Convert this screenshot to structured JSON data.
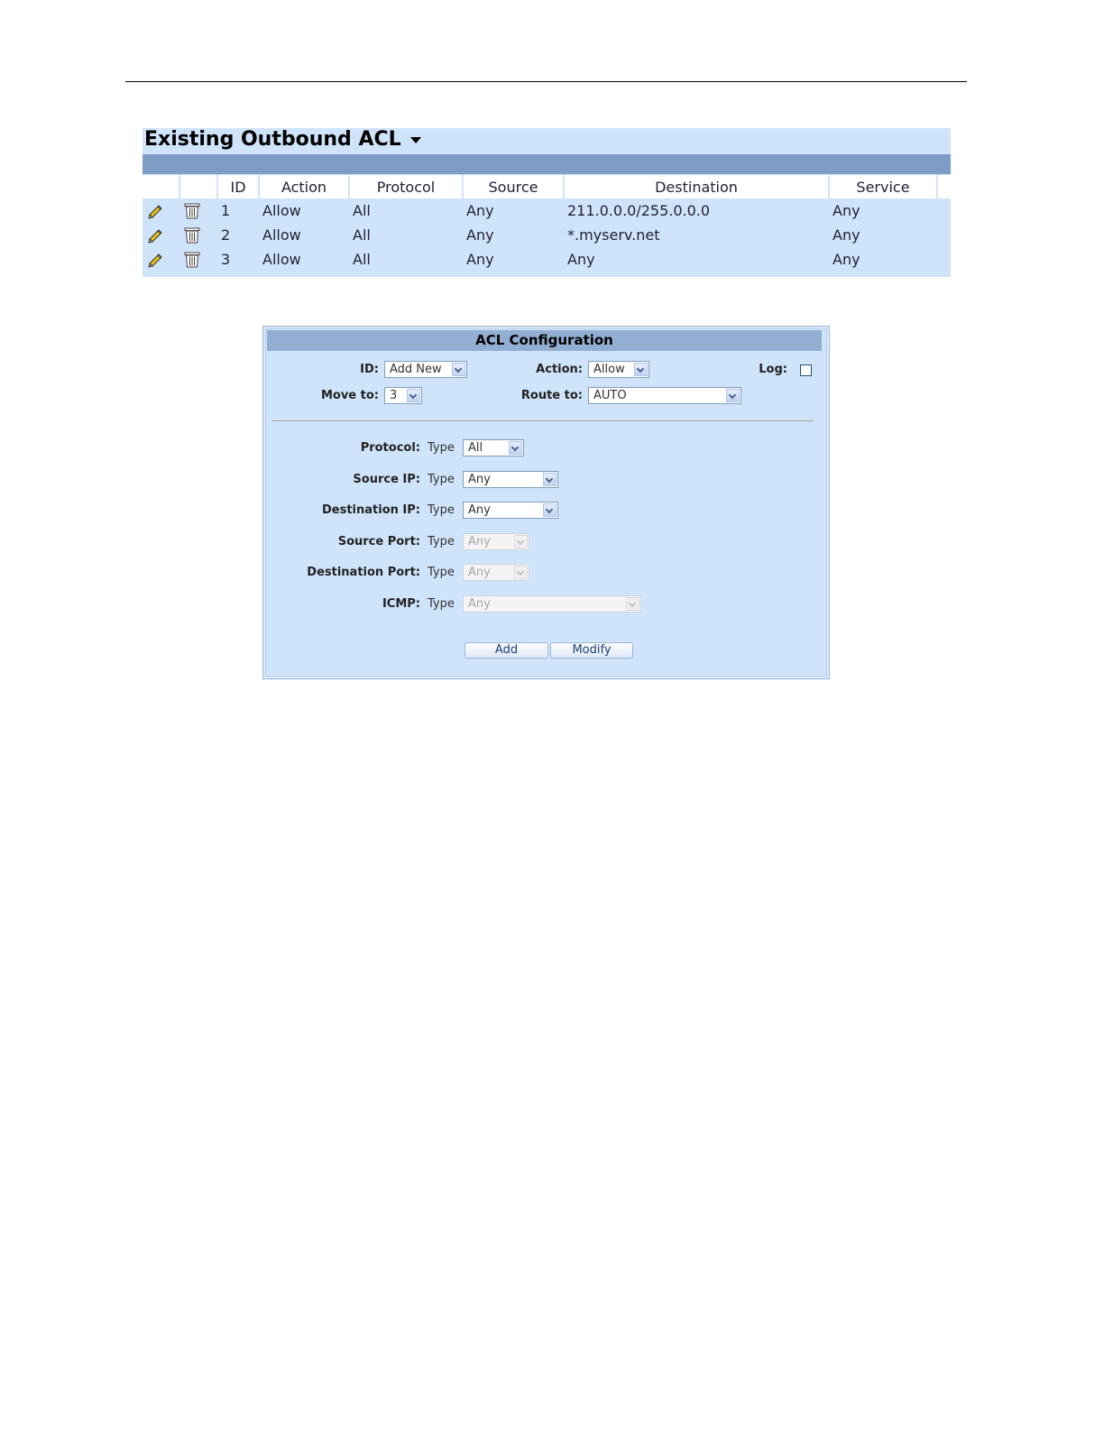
{
  "outbound_acl": {
    "title": "Existing Outbound ACL",
    "columns": [
      "",
      "",
      "ID",
      "Action",
      "Protocol",
      "Source",
      "Destination",
      "Service"
    ],
    "rows": [
      {
        "id": "1",
        "action": "Allow",
        "protocol": "All",
        "source": "Any",
        "destination": "211.0.0.0/255.0.0.0",
        "service": "Any"
      },
      {
        "id": "2",
        "action": "Allow",
        "protocol": "All",
        "source": "Any",
        "destination": "*.myserv.net",
        "service": "Any"
      },
      {
        "id": "3",
        "action": "Allow",
        "protocol": "All",
        "source": "Any",
        "destination": "Any",
        "service": "Any"
      }
    ],
    "row_icons": [
      "pencil-icon",
      "trash-icon"
    ]
  },
  "acl_config": {
    "title": "ACL Configuration",
    "id_label": "ID:",
    "id_value": "Add New",
    "action_label": "Action:",
    "action_value": "Allow",
    "log_label": "Log:",
    "log_checked": false,
    "move_label": "Move to:",
    "move_value": "3",
    "route_label": "Route to:",
    "route_value": "AUTO",
    "type_word": "Type",
    "fields": [
      {
        "label": "Protocol:",
        "value": "All",
        "enabled": true
      },
      {
        "label": "Source IP:",
        "value": "Any",
        "enabled": true
      },
      {
        "label": "Destination IP:",
        "value": "Any",
        "enabled": true
      },
      {
        "label": "Source Port:",
        "value": "Any",
        "enabled": false
      },
      {
        "label": "Destination Port:",
        "value": "Any",
        "enabled": false
      },
      {
        "label": "ICMP:",
        "value": "Any",
        "enabled": false
      }
    ],
    "add_label": "Add",
    "modify_label": "Modify"
  },
  "colors": {
    "panel_bg": "#cfe4fb",
    "band": "#7d9dc6",
    "config_header": "#92afd3"
  }
}
